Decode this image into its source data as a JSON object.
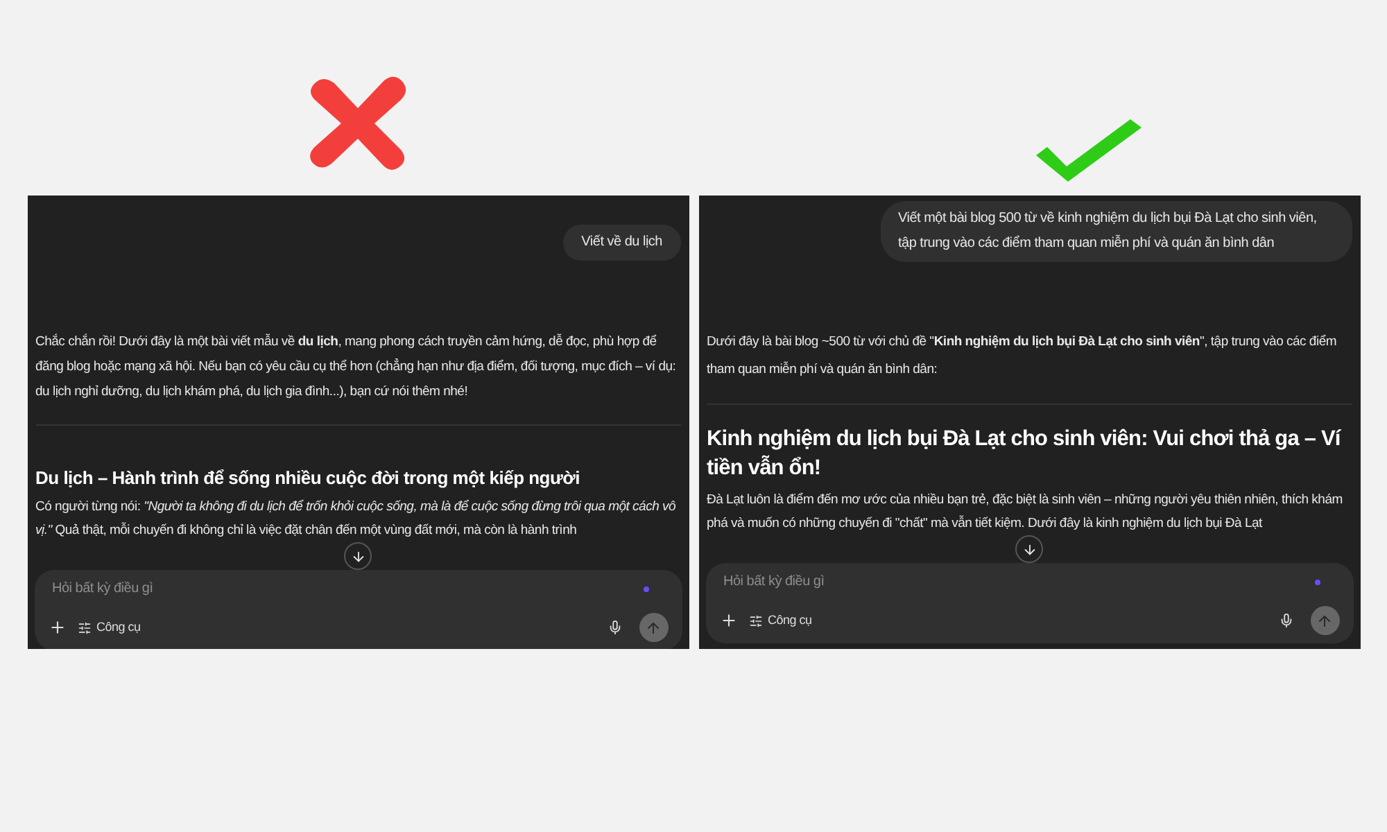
{
  "panels": [
    {
      "kind": "bad",
      "user_message": "Viết về du lịch",
      "intro": "Chắc chắn rồi! Dưới đây là một bài viết mẫu về **du lịch**, mang phong cách truyền cảm hứng, dễ đọc, phù hợp để đăng blog hoặc mạng xã hội. Nếu bạn có yêu cầu cụ thể hơn (chẳng hạn như địa điểm, đối tượng, mục đích – ví dụ: du lịch nghỉ dưỡng, du lịch khám phá, du lịch gia đình...), bạn cứ nói thêm nhé!",
      "heading": "Du lịch – Hành trình để sống nhiều cuộc đời trong một kiếp người",
      "body": "Có người từng nói: *\"Người ta không đi du lịch để trốn khỏi cuộc sống, mà là để cuộc sống đừng trôi qua một cách vô vị.\"* Quả thật, mỗi chuyến đi không chỉ là việc đặt chân đến một vùng đất mới, mà còn là hành trình",
      "composer": {
        "placeholder": "Hỏi bất kỳ điều gì",
        "tools_label": "Công cụ"
      }
    },
    {
      "kind": "good",
      "user_message": "Viết một bài blog 500 từ về kinh nghiệm du lịch bụi Đà Lạt cho sinh viên, tập trung vào các điểm tham quan miễn phí và quán ăn bình dân",
      "intro": "Dưới đây là bài blog ~500 từ với chủ đề \"**Kinh nghiệm du lịch bụi Đà Lạt cho sinh viên**\", tập trung vào các điểm tham quan miễn phí và quán ăn bình dân:",
      "heading": "Kinh nghiệm du lịch bụi Đà Lạt cho sinh viên: Vui chơi thả ga – Ví tiền vẫn ổn!",
      "body": "Đà Lạt luôn là điểm đến mơ ước của nhiều bạn trẻ, đặc biệt là sinh viên – những người yêu thiên nhiên, thích khám phá và muốn có những chuyến đi \"chất\" mà vẫn tiết kiệm. Dưới đây là kinh nghiệm du lịch bụi Đà Lạt",
      "composer": {
        "placeholder": "Hỏi bất kỳ điều gì",
        "tools_label": "Công cụ"
      }
    }
  ]
}
